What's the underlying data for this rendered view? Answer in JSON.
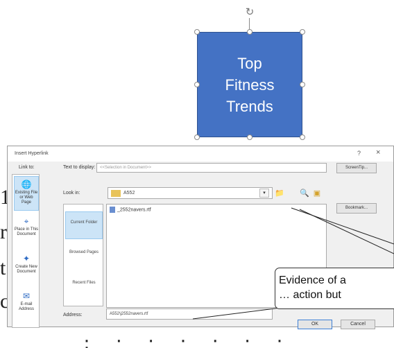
{
  "slide": {
    "shape_text": "Top\nFitness\nTrends",
    "shape_color": "#4472c4",
    "rotate_handle_icon": "rotate-icon"
  },
  "dialog": {
    "title": "Insert Hyperlink",
    "help": "?",
    "close": "×",
    "link_to_label": "Link to:",
    "link_to_items": [
      {
        "label": "Existing File or Web Page",
        "icon": "globe-page-icon"
      },
      {
        "label": "Place in This Document",
        "icon": "document-place-icon"
      },
      {
        "label": "Create New Document",
        "icon": "new-document-icon"
      },
      {
        "label": "E-mail Address",
        "icon": "email-icon"
      }
    ],
    "text_to_display_label": "Text to display:",
    "text_to_display_value": "<<Selection in Document>>",
    "screentip_label": "ScreenTip...",
    "look_in_label": "Look in:",
    "look_in_value": "A552",
    "bookmark_label": "Bookmark...",
    "subnav_items": [
      "Current Folder",
      "Browsed Pages",
      "Recent Files"
    ],
    "files": [
      "_2552navers.rtf"
    ],
    "address_label": "Address:",
    "address_value": "A552\\j2552navers.rtf",
    "ok_label": "OK",
    "cancel_label": "Cancel"
  },
  "callout": {
    "line1": "Evidence of a",
    "line2": "… action but"
  }
}
